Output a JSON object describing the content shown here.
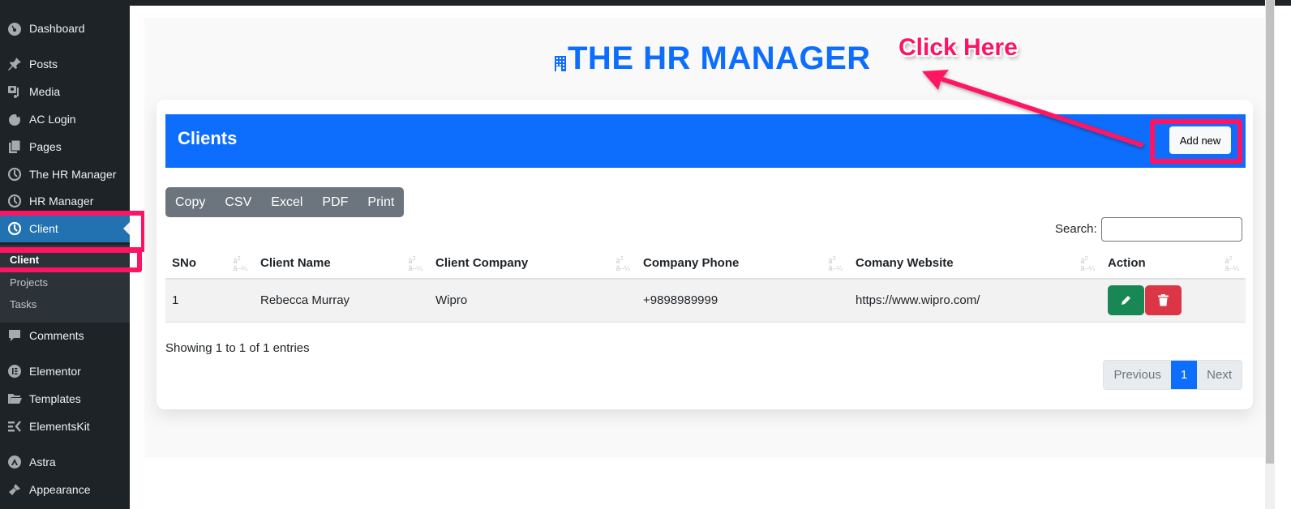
{
  "sidebar": {
    "items": [
      {
        "label": "Dashboard",
        "icon": "dashboard-icon"
      },
      {
        "label": "Posts",
        "icon": "pin-icon"
      },
      {
        "label": "Media",
        "icon": "media-icon"
      },
      {
        "label": "AC Login",
        "icon": "ac-login-icon"
      },
      {
        "label": "Pages",
        "icon": "pages-icon"
      },
      {
        "label": "The HR Manager",
        "icon": "clock-icon"
      },
      {
        "label": "HR Manager",
        "icon": "clock-icon"
      },
      {
        "label": "Client",
        "icon": "clock-icon",
        "current": true
      },
      {
        "label": "Comments",
        "icon": "comment-icon"
      },
      {
        "label": "Elementor",
        "icon": "elementor-icon"
      },
      {
        "label": "Templates",
        "icon": "folder-icon"
      },
      {
        "label": "ElementsKit",
        "icon": "elementskit-icon"
      },
      {
        "label": "Astra",
        "icon": "astra-icon"
      },
      {
        "label": "Appearance",
        "icon": "brush-icon"
      }
    ],
    "submenu": [
      {
        "label": "Client",
        "current": true
      },
      {
        "label": "Projects"
      },
      {
        "label": "Tasks"
      }
    ]
  },
  "header": {
    "title": "THE HR MANAGER",
    "title_icon": "building-icon"
  },
  "card": {
    "title": "Clients",
    "add_button": "Add new"
  },
  "export_buttons": [
    "Copy",
    "CSV",
    "Excel",
    "PDF",
    "Print"
  ],
  "search": {
    "label": "Search:",
    "value": "",
    "placeholder": ""
  },
  "table": {
    "columns": [
      "SNo",
      "Client Name",
      "Client Company",
      "Company Phone",
      "Comany Website",
      "Action"
    ],
    "sort_glyph": "â–²â–¼",
    "rows": [
      {
        "sno": "1",
        "name": "Rebecca Murray",
        "company": "Wipro",
        "phone": "+9898989999",
        "website": "https://www.wipro.com/"
      }
    ]
  },
  "info_text": "Showing 1 to 1 of 1 entries",
  "pagination": {
    "previous": "Previous",
    "current_page": "1",
    "next": "Next"
  },
  "annotation": {
    "text": "Click Here",
    "color": "#ff1363"
  },
  "colors": {
    "primary": "#0d6efd",
    "sidebar_bg": "#1d2327",
    "sidebar_current": "#2271b1",
    "edit": "#198754",
    "delete": "#dc3545",
    "secondary": "#6c757d"
  }
}
